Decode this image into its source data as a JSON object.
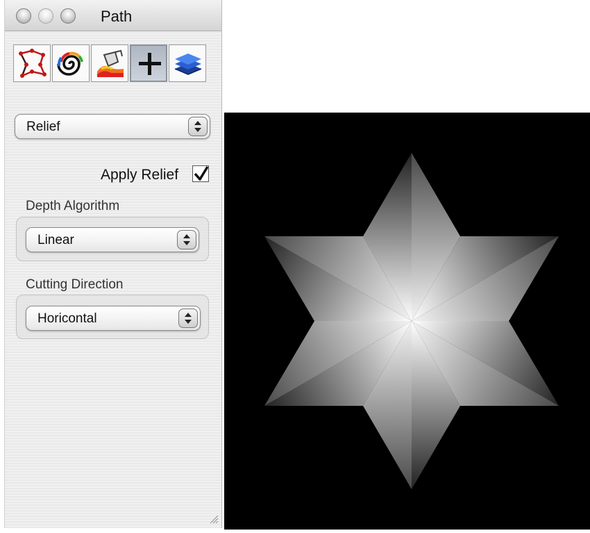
{
  "window": {
    "title": "Path",
    "buttons": [
      "close",
      "minimize",
      "zoom"
    ]
  },
  "toolbar": {
    "tools": [
      {
        "name": "path-points-tool",
        "icon": "path-nodes-icon"
      },
      {
        "name": "color-spiral-tool",
        "icon": "color-spiral-icon"
      },
      {
        "name": "paint-fill-tool",
        "icon": "paint-bucket-icon"
      },
      {
        "name": "relief-tool",
        "icon": "plus-icon",
        "active": true
      },
      {
        "name": "layers-tool",
        "icon": "layers-icon"
      }
    ]
  },
  "panel": {
    "mode_select": "Relief",
    "apply_relief_label": "Apply Relief",
    "apply_relief_checked": true,
    "depth_algorithm_label": "Depth Algorithm",
    "depth_algorithm_value": "Linear",
    "cutting_direction_label": "Cutting Direction",
    "cutting_direction_value": "Horicontal"
  },
  "preview": {
    "shape": "six-pointed-star",
    "background": "#000000",
    "center_color": "#ffffff"
  }
}
